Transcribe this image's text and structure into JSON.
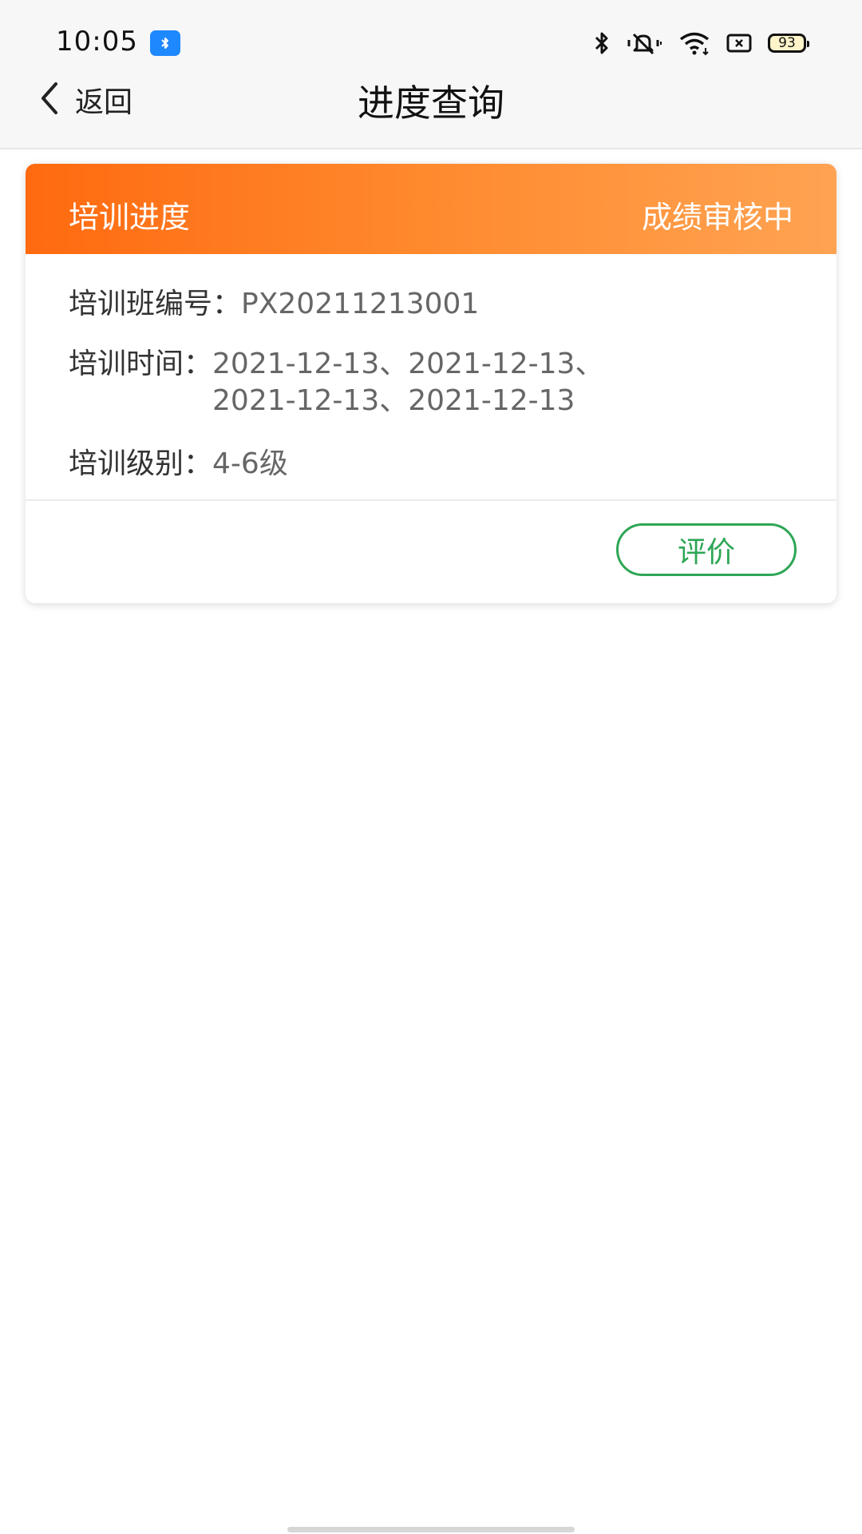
{
  "status_bar": {
    "time": "10:05",
    "battery": "93",
    "icons": [
      "bluetooth-app-icon",
      "bluetooth-icon",
      "mute-icon",
      "wifi-icon",
      "sim-icon",
      "battery-icon"
    ]
  },
  "nav": {
    "back_label": "返回",
    "title": "进度查询"
  },
  "card": {
    "header_title": "培训进度",
    "header_status": "成绩审核中",
    "rows": [
      {
        "label": "培训班编号：",
        "value": "PX20211213001"
      },
      {
        "label": "培训时间：",
        "value_line1": "2021-12-13、2021-12-13、",
        "value_line2": "2021-12-13、2021-12-13"
      },
      {
        "label": "培训级别：",
        "value": "4-6级"
      }
    ],
    "evaluate_label": "评价"
  },
  "colors": {
    "header_gradient_start": "#ff6a10",
    "header_gradient_end": "#ffa352",
    "evaluate_green": "#2ea655",
    "bt_chip_blue": "#1e88ff"
  }
}
